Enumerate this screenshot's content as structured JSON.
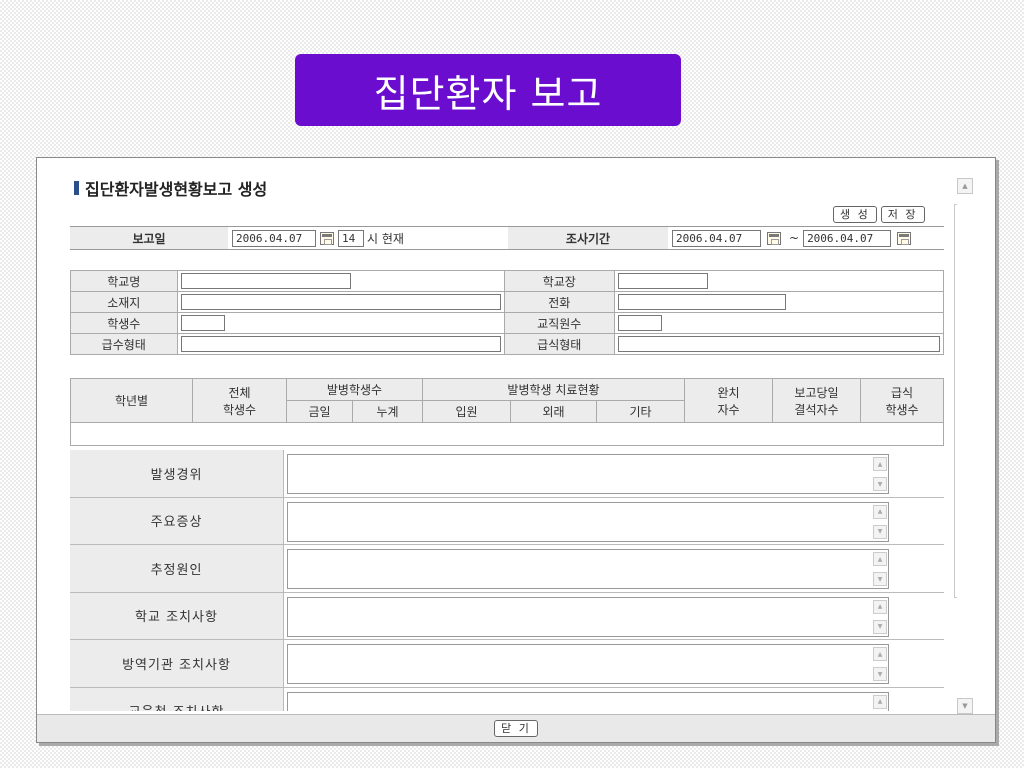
{
  "slide": {
    "title": "집단환자 보고"
  },
  "form": {
    "heading": "집단환자발생현황보고 생성",
    "buttons": {
      "create": "생 성",
      "save": "저 장",
      "close": "닫 기"
    },
    "report": {
      "date_label": "보고일",
      "date_value": "2006.04.07",
      "hour_value": "14",
      "hour_suffix": "시 현재",
      "period_label": "조사기간",
      "period_start": "2006.04.07",
      "period_sep": "~",
      "period_end": "2006.04.07"
    },
    "info": {
      "school_name": "학교명",
      "principal": "학교장",
      "address": "소재지",
      "phone": "전화",
      "students": "학생수",
      "staff": "교직원수",
      "water_type": "급수형태",
      "meal_type": "급식형태"
    },
    "grade_table": {
      "by_grade": "학년별",
      "total_students_1": "전체",
      "total_students_2": "학생수",
      "sick_students": "발병학생수",
      "today": "금일",
      "cumulative": "누계",
      "treatment": "발병학생 치료현황",
      "inpatient": "입원",
      "outpatient": "외래",
      "other": "기타",
      "recovered_1": "완치",
      "recovered_2": "자수",
      "absent_1": "보고당일",
      "absent_2": "결석자수",
      "meal_1": "급식",
      "meal_2": "학생수"
    },
    "details": [
      {
        "label": "발생경위"
      },
      {
        "label": "주요증상"
      },
      {
        "label": "추정원인"
      },
      {
        "label": "학교 조치사항"
      },
      {
        "label": "방역기관 조치사항"
      },
      {
        "label": "교육청 조치사항"
      }
    ]
  },
  "colors": {
    "title_bg": "#6a0dce",
    "label_bg": "#ececec",
    "heading_bar": "#2a4f8c"
  }
}
